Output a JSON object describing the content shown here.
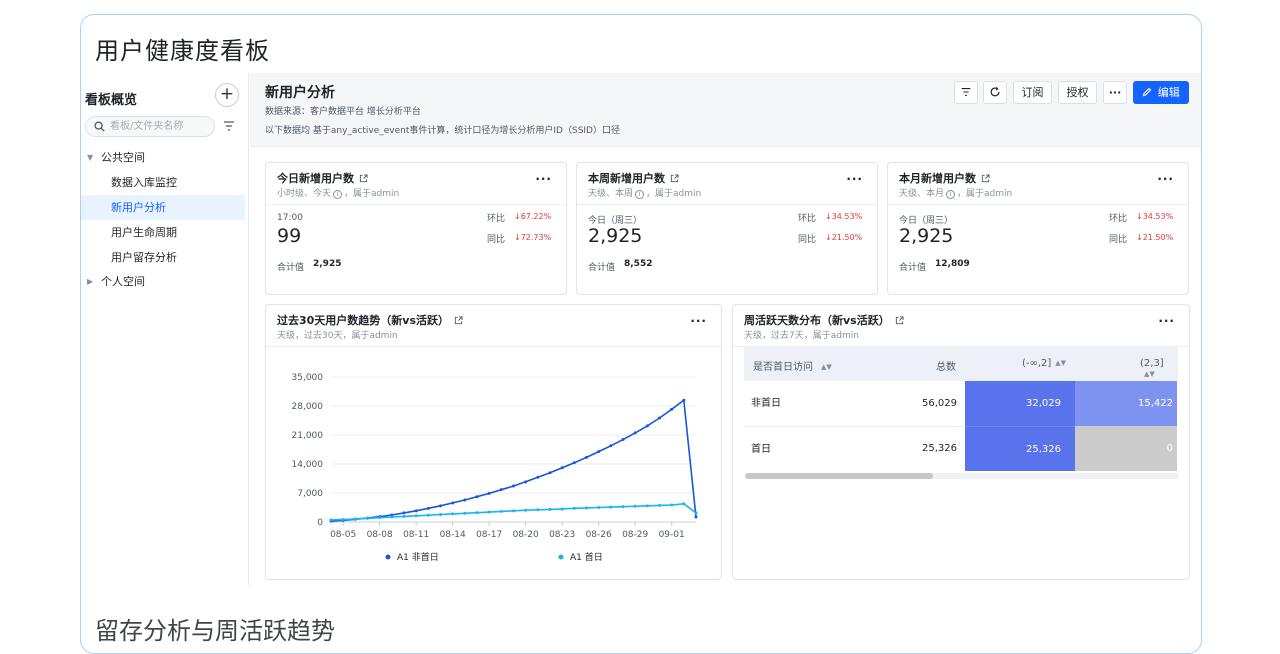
{
  "page": {
    "title": "用户健康度看板",
    "bottom_heading": "留存分析与周活跃趋势"
  },
  "sidebar": {
    "title": "看板概览",
    "search_placeholder": "看板/文件夹名称",
    "tree": [
      {
        "label": "公共空间",
        "level": 0,
        "expanded": true
      },
      {
        "label": "数据入库监控",
        "level": 1
      },
      {
        "label": "新用户分析",
        "level": 1,
        "active": true
      },
      {
        "label": "用户生命周期",
        "level": 1
      },
      {
        "label": "用户留存分析",
        "level": 1
      },
      {
        "label": "个人空间",
        "level": 0,
        "expanded": false
      }
    ]
  },
  "dashboard": {
    "title": "新用户分析",
    "source": "数据来源：客户数据平台 增长分析平台",
    "note": "以下数据均 基于any_active_event事件计算，统计口径为增长分析用户ID（SSID）口径",
    "buttons": {
      "subscribe": "订阅",
      "authorize": "授权",
      "edit": "编辑"
    }
  },
  "kpis": [
    {
      "title": "今日新增用户数",
      "sub_a": "小时级、今天",
      "sub_b": "，属于admin",
      "time": "17:00",
      "value": "99",
      "mom_label": "环比",
      "mom": "67.22%",
      "yoy_label": "同比",
      "yoy": "72.73%",
      "sum_label": "合计值",
      "sum": "2,925"
    },
    {
      "title": "本周新增用户数",
      "sub_a": "天级、本周",
      "sub_b": "，属于admin",
      "time": "今日（周三）",
      "value": "2,925",
      "mom_label": "环比",
      "mom": "34.53%",
      "yoy_label": "同比",
      "yoy": "21.50%",
      "sum_label": "合计值",
      "sum": "8,552"
    },
    {
      "title": "本月新增用户数",
      "sub_a": "天级、本月",
      "sub_b": "，属于admin",
      "time": "今日（周三）",
      "value": "2,925",
      "mom_label": "环比",
      "mom": "34.53%",
      "yoy_label": "同比",
      "yoy": "21.50%",
      "sum_label": "合计值",
      "sum": "12,809"
    }
  ],
  "trend_card": {
    "title": "过去30天用户数趋势（新vs活跃）",
    "sub": "天级，过去30天，属于admin"
  },
  "dist_card": {
    "title": "周活跃天数分布（新vs活跃）",
    "sub": "天级，过去7天，属于admin",
    "columns": [
      "是否首日访问",
      "总数",
      "(-∞,2]",
      "(2,3]"
    ],
    "rows": [
      {
        "label": "非首日",
        "total": "56,029",
        "c1": "32,029",
        "c2": "15,422"
      },
      {
        "label": "首日",
        "total": "25,326",
        "c1": "25,326",
        "c2": "0"
      }
    ],
    "colors": {
      "c1": "#5873eb",
      "c2_row1": "#7e93ef",
      "c2_row2": "#cbcbcb"
    }
  },
  "chart_data": {
    "type": "line",
    "x": [
      "08-04",
      "08-05",
      "08-06",
      "08-07",
      "08-08",
      "08-09",
      "08-10",
      "08-11",
      "08-12",
      "08-13",
      "08-14",
      "08-15",
      "08-16",
      "08-17",
      "08-18",
      "08-19",
      "08-20",
      "08-21",
      "08-22",
      "08-23",
      "08-24",
      "08-25",
      "08-26",
      "08-27",
      "08-28",
      "08-29",
      "08-30",
      "08-31",
      "09-01",
      "09-02",
      "09-03"
    ],
    "x_tick_labels": [
      "08-05",
      "08-08",
      "08-11",
      "08-14",
      "08-17",
      "08-20",
      "08-23",
      "08-26",
      "08-29",
      "09-01"
    ],
    "y_tick_labels": [
      "0",
      "7,000",
      "14,000",
      "21,000",
      "28,000",
      "35,000"
    ],
    "ylim": [
      0,
      35000
    ],
    "series": [
      {
        "name": "A1  非首日",
        "color": "#1a56db",
        "values": [
          200,
          400,
          650,
          950,
          1300,
          1700,
          2200,
          2700,
          3300,
          3900,
          4600,
          5300,
          6100,
          6900,
          7800,
          8700,
          9700,
          10800,
          11900,
          13100,
          14300,
          15600,
          17000,
          18400,
          19900,
          21500,
          23200,
          25100,
          27200,
          29400,
          1200
        ]
      },
      {
        "name": "A1  首日",
        "color": "#18b6f0",
        "values": [
          500,
          600,
          750,
          900,
          1050,
          1200,
          1350,
          1500,
          1650,
          1800,
          1950,
          2100,
          2250,
          2400,
          2550,
          2700,
          2850,
          2950,
          3050,
          3150,
          3300,
          3400,
          3500,
          3600,
          3700,
          3800,
          3900,
          4000,
          4100,
          4400,
          2200
        ]
      }
    ],
    "legend_position": "bottom",
    "grid": true
  }
}
